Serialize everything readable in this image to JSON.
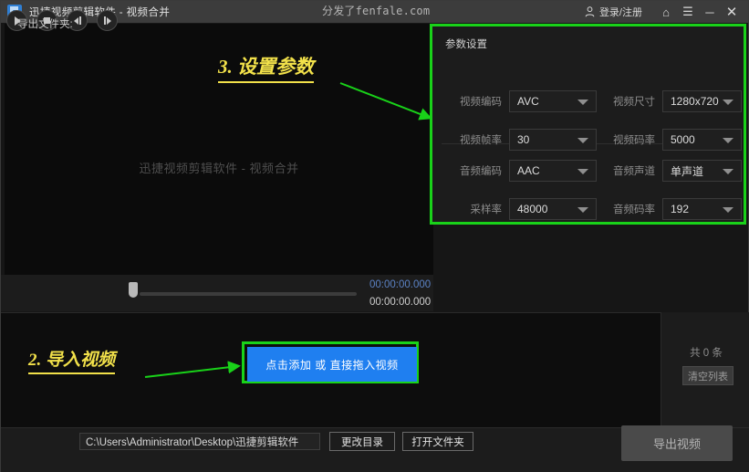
{
  "titlebar": {
    "app_title": "迅捷视频剪辑软件 - 视频合并",
    "watermark": "分发了fenfale.com",
    "login": "登录/注册",
    "icons": {
      "home": "⌂",
      "menu": "☰",
      "minimize": "－",
      "close": "✕"
    }
  },
  "preview": {
    "placeholder": "迅捷视频剪辑软件 - 视频合并"
  },
  "annotations": {
    "step3": "3. 设置参数",
    "step2": "2. 导入视频",
    "arrow_color": "#19d219",
    "text_color": "#f2e14a"
  },
  "params": {
    "title": "参数设置",
    "highlight_color": "#19d219",
    "fields": [
      {
        "label": "视频编码",
        "value": "AVC"
      },
      {
        "label": "视频尺寸",
        "value": "1280x720"
      },
      {
        "label": "视频帧率",
        "value": "30"
      },
      {
        "label": "视频码率",
        "value": "5000"
      },
      {
        "label": "音频编码",
        "value": "AAC"
      },
      {
        "label": "音频声道",
        "value": "单声道"
      },
      {
        "label": "采样率",
        "value": "48000"
      },
      {
        "label": "音频码率",
        "value": "192"
      }
    ]
  },
  "player": {
    "buttons": [
      "play-button",
      "stop-button",
      "prev-frame-button",
      "next-frame-button"
    ],
    "current_time": "00:00:00.000",
    "total_time": "00:00:00.000",
    "progress_percent": 0
  },
  "list": {
    "add_button": "点击添加 或 直接拖入视频",
    "count_label": "共 0 条",
    "clear_button": "清空列表",
    "add_button_color": "#1f7ff0"
  },
  "footer": {
    "export_folder_label": "导出文件夹:",
    "export_path": "C:\\Users\\Administrator\\Desktop\\迅捷剪辑软件",
    "change_dir_button": "更改目录",
    "open_folder_button": "打开文件夹",
    "export_button": "导出视频"
  }
}
